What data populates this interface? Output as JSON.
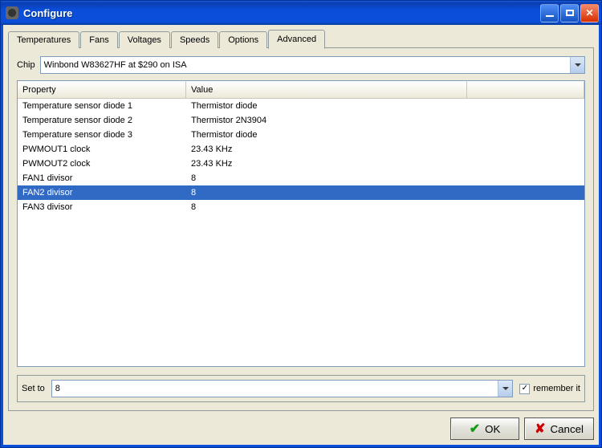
{
  "window": {
    "title": "Configure"
  },
  "tabs": {
    "items": [
      {
        "label": "Temperatures",
        "active": false
      },
      {
        "label": "Fans",
        "active": false
      },
      {
        "label": "Voltages",
        "active": false
      },
      {
        "label": "Speeds",
        "active": false
      },
      {
        "label": "Options",
        "active": false
      },
      {
        "label": "Advanced",
        "active": true
      }
    ]
  },
  "chip": {
    "label": "Chip",
    "selected": "Winbond W83627HF at $290 on ISA"
  },
  "table": {
    "columns": {
      "property": "Property",
      "value": "Value"
    },
    "rows": [
      {
        "property": "Temperature sensor diode 1",
        "value": "Thermistor diode",
        "selected": false
      },
      {
        "property": "Temperature sensor diode 2",
        "value": "Thermistor 2N3904",
        "selected": false
      },
      {
        "property": "Temperature sensor diode 3",
        "value": "Thermistor diode",
        "selected": false
      },
      {
        "property": "PWMOUT1 clock",
        "value": "23.43 KHz",
        "selected": false
      },
      {
        "property": "PWMOUT2 clock",
        "value": "23.43 KHz",
        "selected": false
      },
      {
        "property": "FAN1 divisor",
        "value": "8",
        "selected": false
      },
      {
        "property": "FAN2 divisor",
        "value": "8",
        "selected": true
      },
      {
        "property": "FAN3 divisor",
        "value": "8",
        "selected": false
      }
    ]
  },
  "setto": {
    "label": "Set to",
    "selected": "8",
    "remember_label": "remember it",
    "remember_checked": true
  },
  "buttons": {
    "ok": "OK",
    "cancel": "Cancel"
  }
}
